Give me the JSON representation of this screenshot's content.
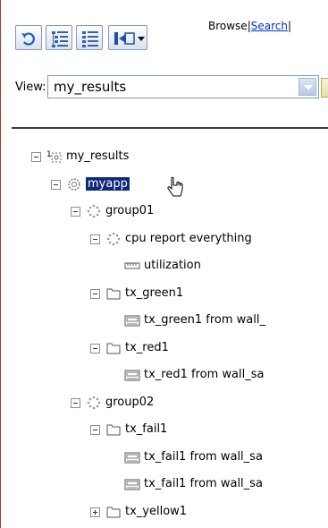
{
  "toolbar": {
    "refresh_icon": "refresh-icon",
    "tree_view_icon": "tree-view-icon",
    "list_view_icon": "list-view-icon",
    "nav_dropdown_icon": "navigate-dropdown-icon",
    "browse_label": "Browse",
    "separator": "|",
    "search_label": "Search",
    "trailing_separator": "|"
  },
  "view": {
    "label": "View:",
    "selected": "my_results",
    "more_button": "..."
  },
  "tree": [
    {
      "label": "my_results",
      "icon": "results-root-icon",
      "toggle": "minus",
      "level": 0
    },
    {
      "label": "myapp",
      "icon": "app-gear-icon",
      "toggle": "minus",
      "level": 1,
      "selected": true
    },
    {
      "label": "group01",
      "icon": "group-dots-icon",
      "toggle": "minus",
      "level": 2
    },
    {
      "label": "cpu report everything",
      "icon": "group-dots-icon",
      "toggle": "minus",
      "level": 3
    },
    {
      "label": "utilization",
      "icon": "ruler-icon",
      "toggle": "none",
      "level": 4
    },
    {
      "label": "tx_green1",
      "icon": "folder-icon",
      "toggle": "minus",
      "level": 3
    },
    {
      "label": "tx_green1 from wall_",
      "icon": "metric-icon",
      "toggle": "none",
      "level": 4
    },
    {
      "label": "tx_red1",
      "icon": "folder-icon",
      "toggle": "minus",
      "level": 3
    },
    {
      "label": "tx_red1 from wall_sa",
      "icon": "metric-icon",
      "toggle": "none",
      "level": 4
    },
    {
      "label": "group02",
      "icon": "group-dots-icon",
      "toggle": "minus",
      "level": 2
    },
    {
      "label": "tx_fail1",
      "icon": "folder-icon",
      "toggle": "minus",
      "level": 3
    },
    {
      "label": "tx_fail1 from wall_sa",
      "icon": "metric-icon",
      "toggle": "none",
      "level": 4
    },
    {
      "label": "tx_fail1 from wall_sa",
      "icon": "metric-icon",
      "toggle": "none",
      "level": 4
    },
    {
      "label": "tx_yellow1",
      "icon": "folder-icon",
      "toggle": "plus",
      "level": 3
    }
  ],
  "colors": {
    "selection_bg": "#102a7b",
    "link": "#0033cc",
    "frame_left_border": "#b8342e"
  }
}
